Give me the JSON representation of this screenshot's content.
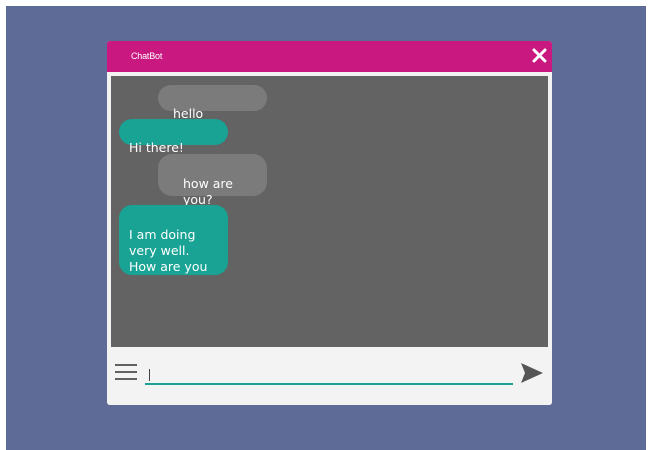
{
  "app": {
    "title": "ChatBot"
  },
  "messages": [
    {
      "sender": "user",
      "text": "hello"
    },
    {
      "sender": "bot",
      "text": "Hi there!"
    },
    {
      "sender": "user",
      "text": "how are\nyou?"
    },
    {
      "sender": "bot",
      "text": "I am doing\nvery well.\nHow are you"
    }
  ],
  "input": {
    "value": "",
    "placeholder": ""
  },
  "icons": {
    "close": "close-icon",
    "menu": "hamburger-menu-icon",
    "send": "send-icon"
  },
  "colors": {
    "backdrop": "#5d6b96",
    "titlebar": "#c9187f",
    "message_area": "#636363",
    "user_bubble": "#7b7b7b",
    "bot_bubble": "#18a394",
    "input_underline": "#18a394",
    "window_background": "#f3f3f3"
  }
}
